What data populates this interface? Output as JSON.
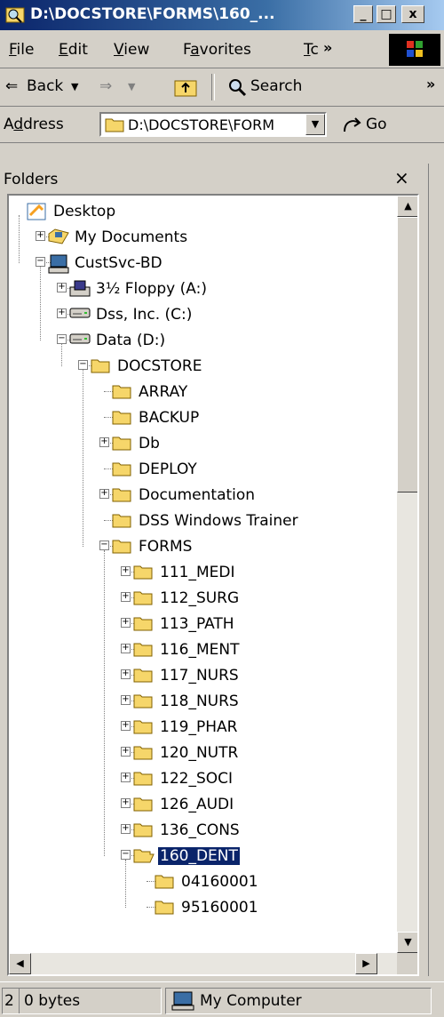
{
  "window": {
    "title": "D:\\DOCSTORE\\FORMS\\160_...",
    "controls": [
      "_",
      "□",
      "x"
    ]
  },
  "menu": {
    "items": [
      {
        "pre": "",
        "u": "F",
        "post": "ile"
      },
      {
        "pre": "",
        "u": "E",
        "post": "dit"
      },
      {
        "pre": "",
        "u": "V",
        "post": "iew"
      },
      {
        "pre": "F",
        "u": "a",
        "post": "vorites"
      },
      {
        "pre": "",
        "u": "T",
        "post": "c"
      }
    ],
    "more": "»"
  },
  "toolbar": {
    "back_label": "Back",
    "search_label": "Search",
    "more": "»"
  },
  "address": {
    "label_pre": "A",
    "label_u": "d",
    "label_post": "dress",
    "value": "D:\\DOCSTORE\\FORM",
    "go_label": "Go"
  },
  "folders_pane": {
    "title": "Folders",
    "close": "×"
  },
  "tree": [
    {
      "label": "Desktop",
      "icon": "desktop-icon",
      "expander": "none"
    },
    {
      "label": "My Documents",
      "icon": "my-documents-icon",
      "expander": "+"
    },
    {
      "label": "CustSvc-BD",
      "icon": "computer-icon",
      "expander": "-"
    },
    {
      "label": "3½ Floppy (A:)",
      "icon": "floppy-icon",
      "expander": "+"
    },
    {
      "label": "Dss, Inc. (C:)",
      "icon": "drive-icon",
      "expander": "+"
    },
    {
      "label": "Data (D:)",
      "icon": "drive-icon",
      "expander": "-"
    },
    {
      "label": "DOCSTORE",
      "icon": "folder-icon",
      "expander": "-"
    },
    {
      "label": "ARRAY",
      "icon": "folder-icon",
      "expander": "none"
    },
    {
      "label": "BACKUP",
      "icon": "folder-icon",
      "expander": "none"
    },
    {
      "label": "Db",
      "icon": "folder-icon",
      "expander": "+"
    },
    {
      "label": "DEPLOY",
      "icon": "folder-icon",
      "expander": "none"
    },
    {
      "label": "Documentation",
      "icon": "folder-icon",
      "expander": "+"
    },
    {
      "label": "DSS Windows Trainer",
      "icon": "folder-icon",
      "expander": "none"
    },
    {
      "label": "FORMS",
      "icon": "folder-icon",
      "expander": "-"
    },
    {
      "label": "111_MEDI",
      "icon": "folder-icon",
      "expander": "+"
    },
    {
      "label": "112_SURG",
      "icon": "folder-icon",
      "expander": "+"
    },
    {
      "label": "113_PATH",
      "icon": "folder-icon",
      "expander": "+"
    },
    {
      "label": "116_MENT",
      "icon": "folder-icon",
      "expander": "+"
    },
    {
      "label": "117_NURS",
      "icon": "folder-icon",
      "expander": "+"
    },
    {
      "label": "118_NURS",
      "icon": "folder-icon",
      "expander": "+"
    },
    {
      "label": "119_PHAR",
      "icon": "folder-icon",
      "expander": "+"
    },
    {
      "label": "120_NUTR",
      "icon": "folder-icon",
      "expander": "+"
    },
    {
      "label": "122_SOCI",
      "icon": "folder-icon",
      "expander": "+"
    },
    {
      "label": "126_AUDI",
      "icon": "folder-icon",
      "expander": "+"
    },
    {
      "label": "136_CONS",
      "icon": "folder-icon",
      "expander": "+"
    },
    {
      "label": "160_DENT",
      "icon": "open-folder-icon",
      "expander": "-",
      "selected": true
    },
    {
      "label": "04160001",
      "icon": "folder-icon",
      "expander": "none"
    },
    {
      "label": "95160001",
      "icon": "folder-icon",
      "expander": "none"
    }
  ],
  "status": {
    "count": "2",
    "size": "0 bytes",
    "zone": "My Computer"
  },
  "colors": {
    "title_gradient_start": "#0a246a",
    "title_gradient_end": "#a6caf0",
    "selection": "#0a246a",
    "folder_yellow": "#f6d66a"
  }
}
